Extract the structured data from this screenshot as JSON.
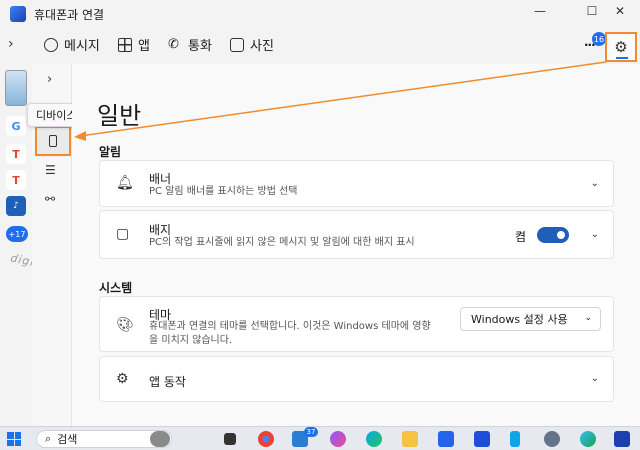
{
  "window": {
    "title": "휴대폰과 연결",
    "controls": {
      "minimize": "—",
      "maximize": "☐",
      "close": "✕"
    }
  },
  "navbar": {
    "tabs": [
      {
        "label": "메시지",
        "icon": "message-icon"
      },
      {
        "label": "앱",
        "icon": "apps-icon"
      },
      {
        "label": "통화",
        "icon": "phone-icon"
      },
      {
        "label": "사진",
        "icon": "photo-icon"
      }
    ],
    "more_badge": "16"
  },
  "rail": {
    "more_apps": "+17",
    "watermark": "digitalline"
  },
  "subnav": {
    "tooltip": "디바이스"
  },
  "page": {
    "title": "일반"
  },
  "sections": [
    {
      "title": "알림",
      "cards": [
        {
          "title": "배너",
          "desc": "PC 알림 배너를 표시하는 방법 선택"
        },
        {
          "title": "배지",
          "desc": "PC의 작업 표시줄에 읽지 않은 메시지 및 알림에 대한 배지 표시",
          "toggle_label": "켬",
          "toggle_on": true
        }
      ]
    },
    {
      "title": "시스템",
      "cards": [
        {
          "title": "테마",
          "desc_line1": "휴대폰과 연결의 테마를 선택합니다. 이것은 Windows 테마에 영향",
          "desc_line2": "을 미치지 않습니다.",
          "dropdown_value": "Windows 설정 사용"
        },
        {
          "title": "앱 동작"
        }
      ]
    }
  ],
  "taskbar": {
    "search_placeholder": "검색",
    "mail_badge": "37"
  },
  "colors": {
    "accent": "#1f6feb",
    "highlight": "#f08c2e"
  }
}
